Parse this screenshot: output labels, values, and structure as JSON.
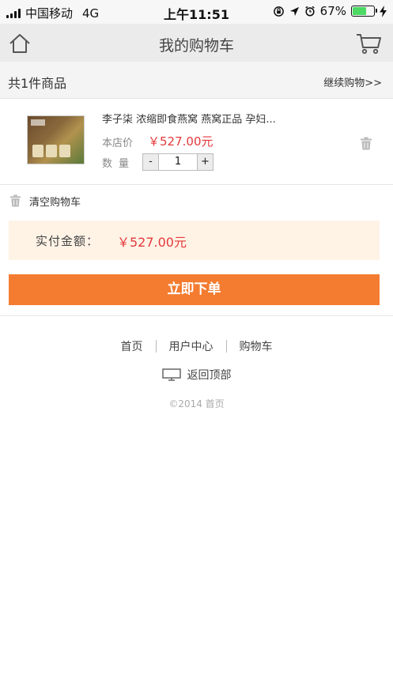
{
  "status_bar": {
    "carrier": "中国移动",
    "network": "4G",
    "time": "上午11:51",
    "battery": "67%",
    "battery_level": 0.67
  },
  "header": {
    "title": "我的购物车",
    "home_icon": "home-icon",
    "cart_icon": "cart-icon"
  },
  "summary": {
    "count_text": "共1件商品",
    "continue_link": "继续购物>>"
  },
  "cart_items": [
    {
      "title": "李子柒 浓缩即食燕窝 燕窝正品 孕妇...",
      "price_label": "本店价",
      "price": "￥527.00元",
      "qty_label": "数量",
      "qty_minus": "-",
      "qty": "1",
      "qty_plus": "+"
    }
  ],
  "clear_cart": {
    "label": "清空购物车"
  },
  "total": {
    "label": "实付金额：",
    "value": "￥527.00元"
  },
  "order_button": {
    "label": "立即下单"
  },
  "footer": {
    "links": [
      "首页",
      "用户中心",
      "购物车"
    ],
    "back_to_top": "返回顶部",
    "copyright": "©2014 首页"
  },
  "colors": {
    "accent": "#f47c30",
    "price": "#e4393c",
    "total_bg": "#fff3e6",
    "battery": "#4cd964"
  }
}
